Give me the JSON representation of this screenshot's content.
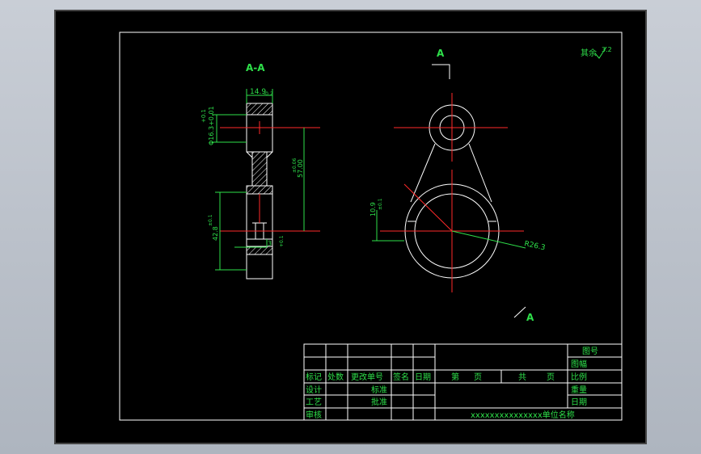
{
  "sheet": {
    "roughness_note": "其余",
    "roughness_value": "3.2"
  },
  "section_view": {
    "title": "A-A",
    "dims": {
      "top_width": "14.9",
      "top_width_tol": "-0.2",
      "bore_dia": "Φ16.3+0.01",
      "bore_tol": "+0.1",
      "center_distance": "57.00",
      "center_tol": "±0.06",
      "big_end_dia": "42.8",
      "big_end_tol": "±0.1",
      "slot_width": "3",
      "slot_tol": "+0.1"
    }
  },
  "front_view": {
    "section_marker_top": "A",
    "section_marker_bottom": "A",
    "radius_dim": "R26.3",
    "side_dim": "10.9",
    "side_tol": "±0.1"
  },
  "title_block": {
    "header_cols": [
      "标记",
      "处数",
      "更改单号",
      "签名",
      "日期"
    ],
    "rows": [
      "设计",
      "工艺",
      "审核"
    ],
    "std_label": "标准",
    "approve_label": "批准",
    "page_no": "第",
    "page_unit": "页",
    "total": "共",
    "total_unit": "页",
    "drawing_no": "图号",
    "frame": "图幅",
    "scale": "比例",
    "weight": "重量",
    "date": "日期",
    "company": "xxxxxxxxxxxxxxx单位名称"
  }
}
